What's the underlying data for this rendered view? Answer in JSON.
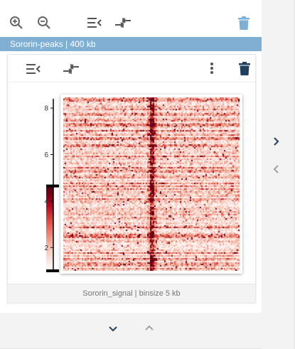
{
  "toolbar": {
    "zoom_in": "zoom-in-icon",
    "zoom_out": "zoom-out-icon",
    "collapse": "collapse-left-icon",
    "merge": "merge-arrows-icon",
    "delete": "trash-icon"
  },
  "panel": {
    "title": "Sororin-peaks | 400 kb",
    "title_bg": "#7fb0d3"
  },
  "track": {
    "label": "Sororin_signal | binsize 5 kb",
    "colorbar_ticks": [
      "8",
      "6",
      "4",
      "2"
    ],
    "colorbar_tick_values": [
      8,
      6,
      4,
      2
    ],
    "colorbar_range": [
      1,
      8.4
    ],
    "colorbar_fill_top": 4.65,
    "colormap": [
      "#ffffff",
      "#f8c8bd",
      "#e45a4a",
      "#a3001b",
      "#4c0010"
    ]
  },
  "nav": {
    "next": "chevron-right-icon",
    "prev": "chevron-left-icon",
    "down": "chevron-down-icon",
    "up": "chevron-up-icon"
  }
}
